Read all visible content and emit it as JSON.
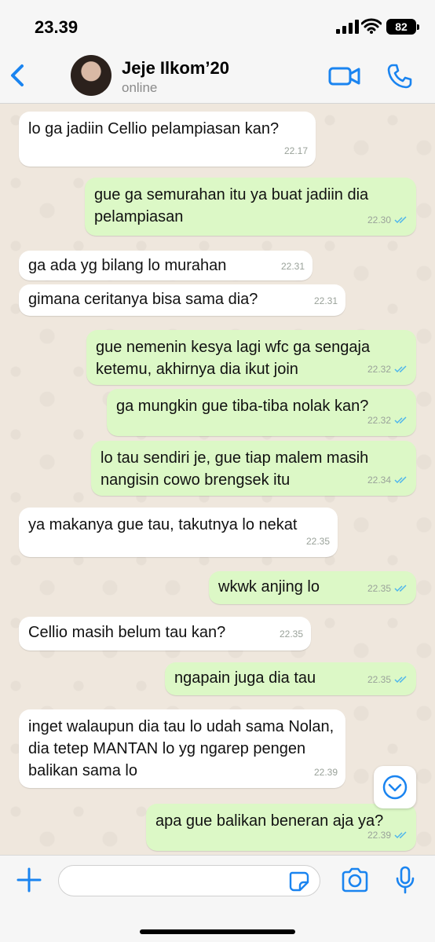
{
  "status_bar": {
    "time": "23.39",
    "battery": "82"
  },
  "header": {
    "contact_name": "Jeje Ilkom’20",
    "status": "online"
  },
  "messages": [
    {
      "text": "lo ga jadiin Cellio pelampiasan kan?",
      "time": "22.17",
      "direction": "in",
      "read": false
    },
    {
      "text": "gue ga semurahan itu ya buat jadiin dia pelampiasan",
      "time": "22.30",
      "direction": "out",
      "read": true
    },
    {
      "text": "ga ada yg bilang lo murahan",
      "time": "22.31",
      "direction": "in",
      "read": false
    },
    {
      "text": "gimana ceritanya bisa sama dia?",
      "time": "22.31",
      "direction": "in",
      "read": false
    },
    {
      "text": "gue nemenin kesya lagi wfc ga sengaja ketemu, akhirnya dia ikut join",
      "time": "22.32",
      "direction": "out",
      "read": true
    },
    {
      "text": "ga mungkin gue tiba-tiba nolak kan?",
      "time": "22.32",
      "direction": "out",
      "read": true
    },
    {
      "text": "lo tau sendiri je, gue tiap malem masih nangisin cowo brengsek itu",
      "time": "22.34",
      "direction": "out",
      "read": true
    },
    {
      "text": "ya makanya gue tau, takutnya lo nekat",
      "time": "22.35",
      "direction": "in",
      "read": false
    },
    {
      "text": "wkwk anjing lo",
      "time": "22.35",
      "direction": "out",
      "read": true
    },
    {
      "text": "Cellio masih belum tau kan?",
      "time": "22.35",
      "direction": "in",
      "read": false
    },
    {
      "text": "ngapain juga dia tau",
      "time": "22.35",
      "direction": "out",
      "read": true
    },
    {
      "text": "inget walaupun dia tau lo udah sama Nolan, dia tetep MANTAN lo yg ngarep pengen balikan sama lo",
      "time": "22.39",
      "direction": "in",
      "read": false
    },
    {
      "text": "apa gue balikan beneran aja ya?",
      "time": "22.39",
      "direction": "out",
      "read": true
    }
  ],
  "input": {
    "placeholder": "",
    "value": ""
  },
  "colors": {
    "accent": "#1a84f0",
    "outgoing_bubble": "#dcf8c6",
    "incoming_bubble": "#ffffff",
    "read_tick": "#4fb6ec",
    "chat_background": "#efe7dd"
  },
  "icons": [
    "back-icon",
    "video-call-icon",
    "voice-call-icon",
    "scroll-down-icon",
    "plus-icon",
    "sticker-icon",
    "camera-icon",
    "microphone-icon"
  ]
}
